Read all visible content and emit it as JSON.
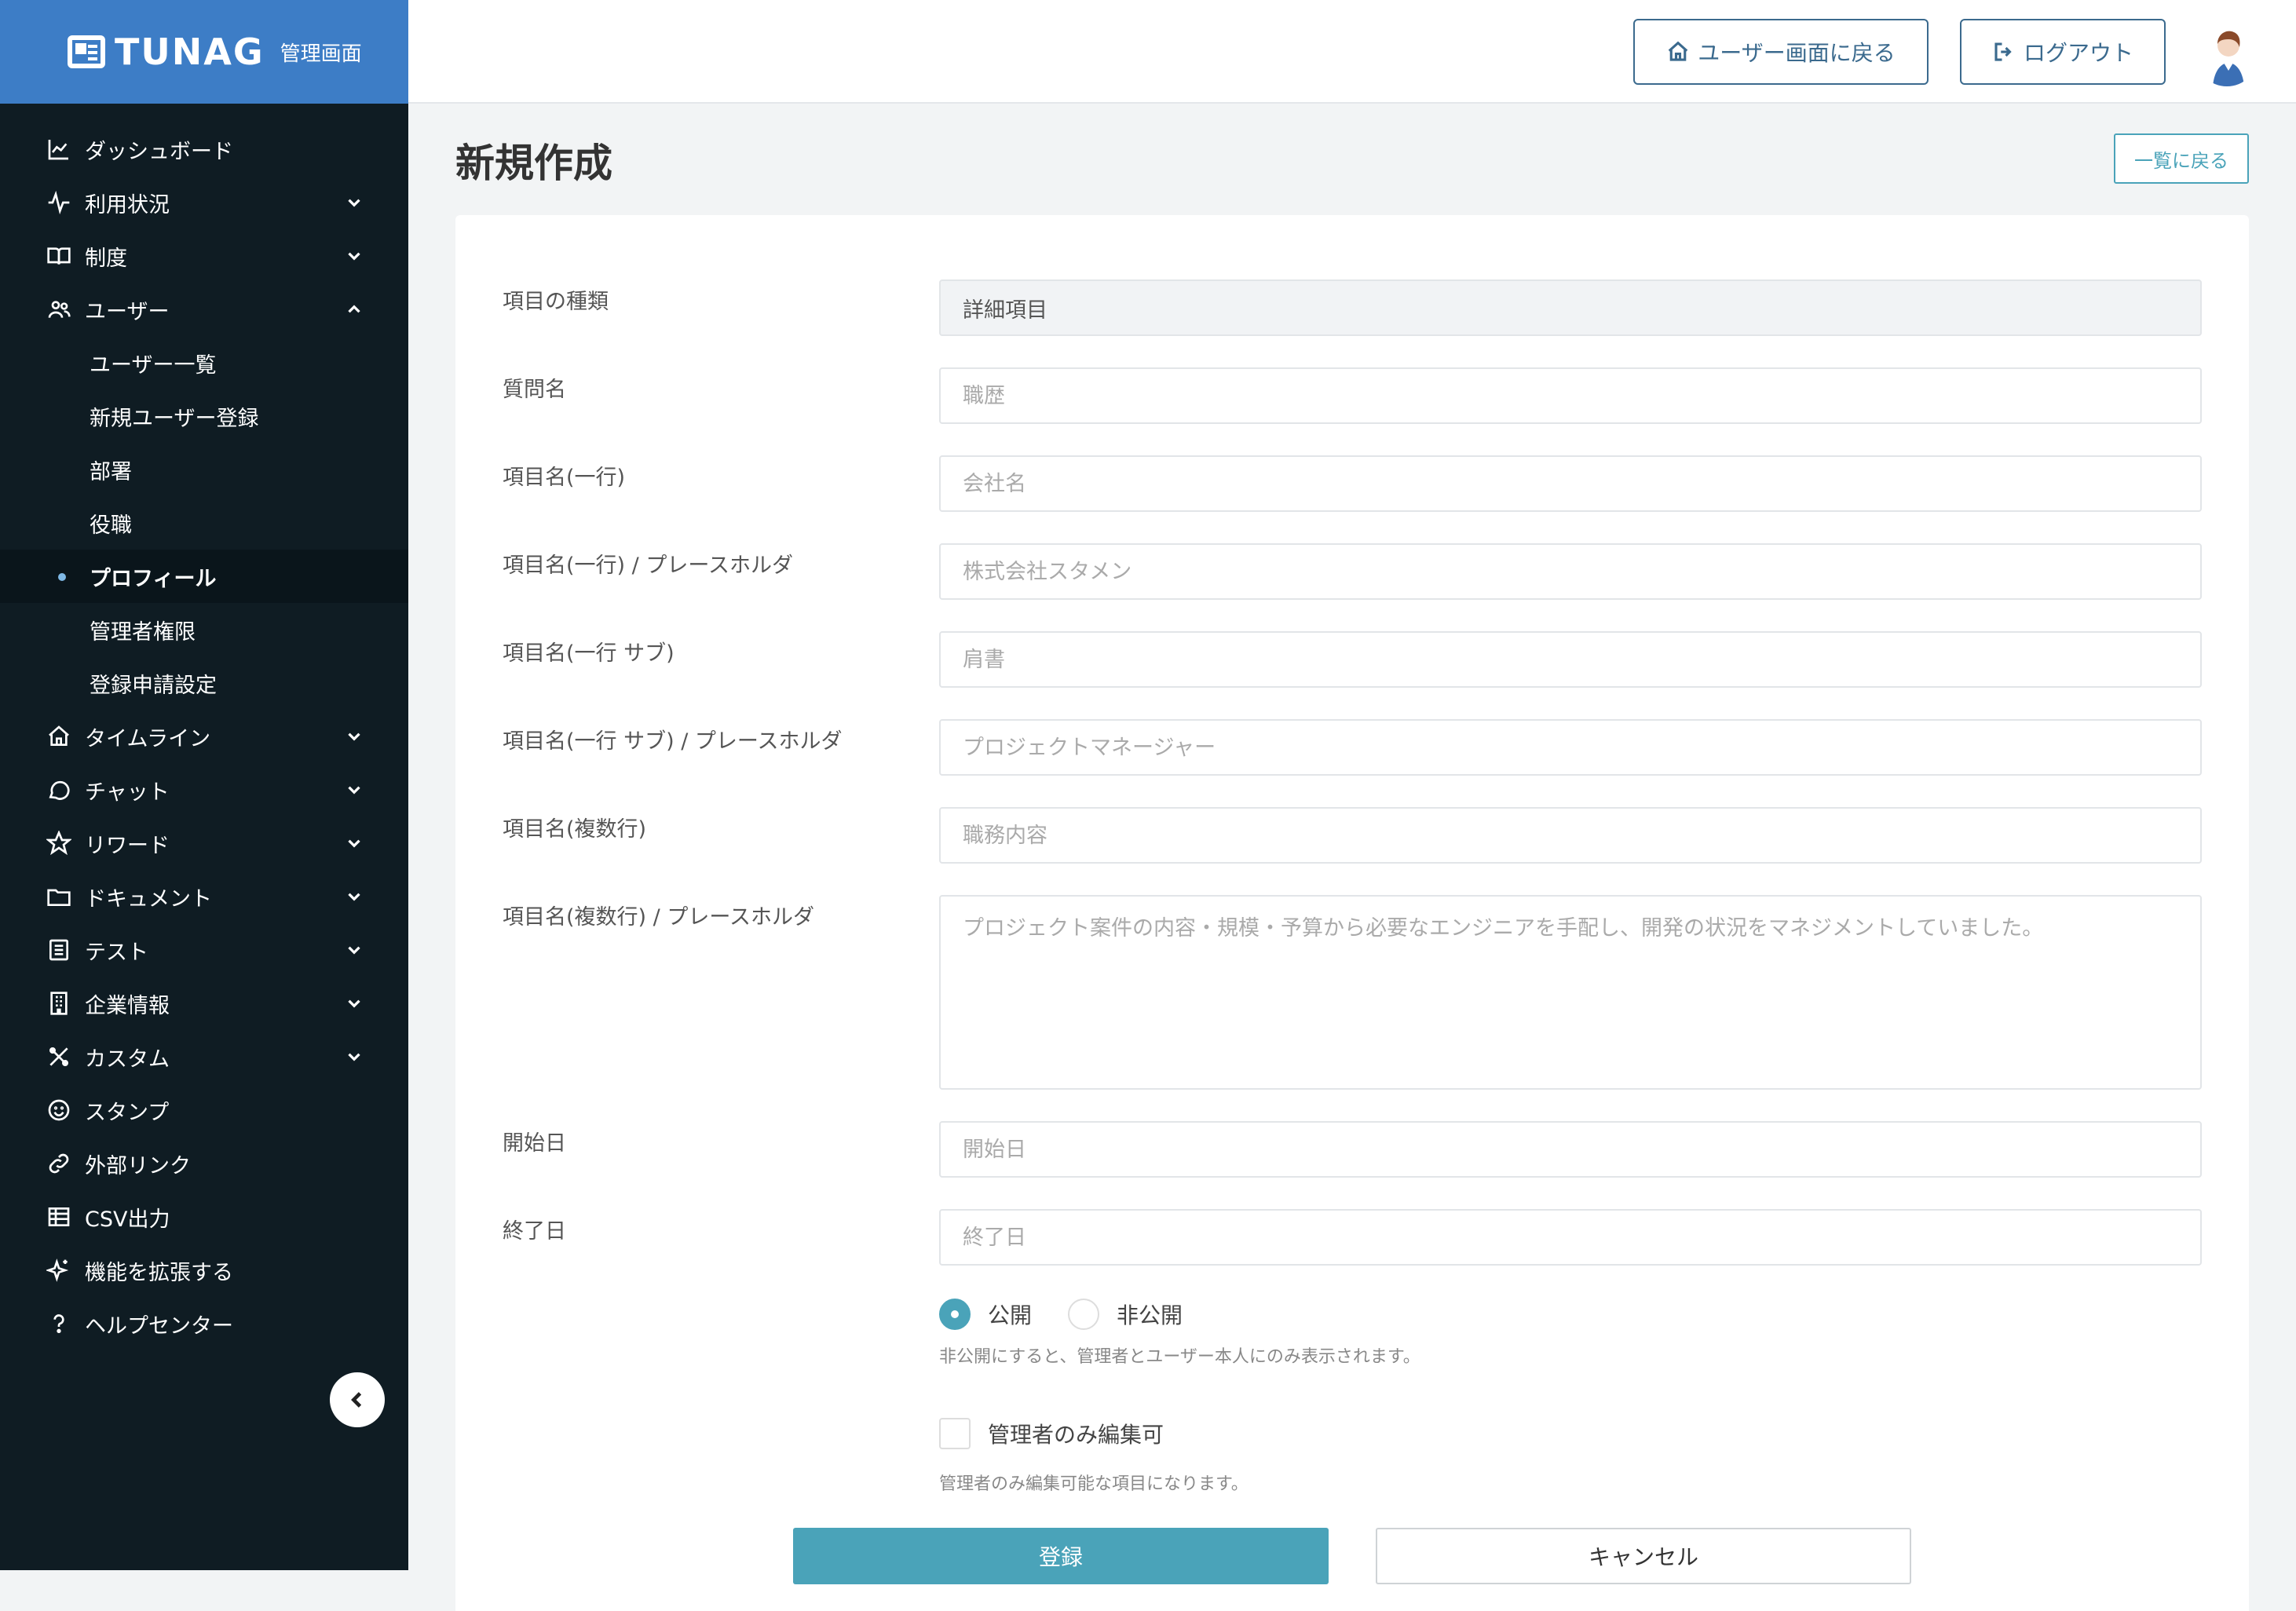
{
  "app": {
    "logo": "TUNAG",
    "logo_sub": "管理画面"
  },
  "header": {
    "user_screen_label": "ユーザー画面に戻る",
    "logout_label": "ログアウト"
  },
  "sidebar": {
    "items": [
      {
        "label": "ダッシュボード",
        "icon": "chart-line-icon"
      },
      {
        "label": "利用状況",
        "icon": "activity-icon"
      },
      {
        "label": "制度",
        "icon": "book-icon"
      },
      {
        "label": "ユーザー",
        "icon": "users-icon"
      },
      {
        "label": "タイムライン",
        "icon": "home-icon"
      },
      {
        "label": "チャット",
        "icon": "chat-icon"
      },
      {
        "label": "リワード",
        "icon": "star-icon"
      },
      {
        "label": "ドキュメント",
        "icon": "folder-icon"
      },
      {
        "label": "テスト",
        "icon": "checklist-icon"
      },
      {
        "label": "企業情報",
        "icon": "building-icon"
      },
      {
        "label": "カスタム",
        "icon": "tools-icon"
      },
      {
        "label": "スタンプ",
        "icon": "smile-icon"
      },
      {
        "label": "外部リンク",
        "icon": "link-icon"
      },
      {
        "label": "CSV出力",
        "icon": "table-icon"
      },
      {
        "label": "機能を拡張する",
        "icon": "sparkle-icon"
      },
      {
        "label": "ヘルプセンター",
        "icon": "help-icon"
      }
    ],
    "user_sub": [
      "ユーザー一覧",
      "新規ユーザー登録",
      "部署",
      "役職",
      "プロフィール",
      "管理者権限",
      "登録申請設定"
    ]
  },
  "page": {
    "title": "新規作成",
    "back_label": "一覧に戻る"
  },
  "form": {
    "type_label": "項目の種類",
    "type_value": "詳細項目",
    "question_label": "質問名",
    "question_placeholder": "職歴",
    "single_label": "項目名(一行)",
    "single_placeholder": "会社名",
    "single_ph_label": "項目名(一行) / プレースホルダ",
    "single_ph_placeholder": "株式会社スタメン",
    "sub_label": "項目名(一行 サブ)",
    "sub_placeholder": "肩書",
    "sub_ph_label": "項目名(一行 サブ) / プレースホルダ",
    "sub_ph_placeholder": "プロジェクトマネージャー",
    "multi_label": "項目名(複数行)",
    "multi_placeholder": "職務内容",
    "multi_ph_label": "項目名(複数行) / プレースホルダ",
    "multi_ph_placeholder": "プロジェクト案件の内容・規模・予算から必要なエンジニアを手配し、開発の状況をマネジメントしていました。",
    "start_label": "開始日",
    "start_placeholder": "開始日",
    "end_label": "終了日",
    "end_placeholder": "終了日",
    "public_label": "公開",
    "private_label": "非公開",
    "visibility_help": "非公開にすると、管理者とユーザー本人にのみ表示されます。",
    "admin_only_label": "管理者のみ編集可",
    "admin_only_help": "管理者のみ編集可能な項目になります。",
    "submit_label": "登録",
    "cancel_label": "キャンセル"
  }
}
